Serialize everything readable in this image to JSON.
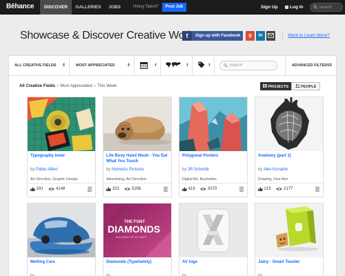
{
  "topnav": {
    "logo": "Bēhance",
    "items": [
      {
        "label": "DISCOVER",
        "active": true
      },
      {
        "label": "GALLERIES",
        "active": false
      },
      {
        "label": "JOBS",
        "active": false
      }
    ],
    "hiring_text": "Hiring Talent?",
    "post_job": "Post Job",
    "sign_up": "Sign Up",
    "log_in": "Log In",
    "search_placeholder": "Search"
  },
  "hero": {
    "title": "Showcase & Discover Creative Work:",
    "facebook_button": "Sign up with Facebook",
    "learn_more": "Want to Learn More?"
  },
  "filters": {
    "creative_fields": "ALL CREATIVE FIELDS",
    "sort": "MOST APPRECIATED",
    "search_placeholder": "Search",
    "advanced": "ADVANCED FILTERS"
  },
  "breadcrumb": {
    "root": "All Creative Fields",
    "sort": "Most Appreciated",
    "period": "This Week"
  },
  "view_toggle": {
    "projects": "PROJECTS",
    "people": "PEOPLE",
    "active": "projects"
  },
  "colors": {
    "accent": "#1769ff",
    "facebook": "#3b5998",
    "google": "#dd4b39",
    "linkedin": "#0e76a8",
    "email": "#444444"
  },
  "projects": [
    {
      "title": "Typography lover",
      "by": "by",
      "author": "Pablo Alfieri",
      "fields": "Art Direction, Graphic Design",
      "likes": "291",
      "views": "4148"
    },
    {
      "title": "Life Buoy Hand Wash - You Eat What You Touch",
      "by": "by",
      "author": "Nemesis Pictures",
      "fields": "Advertising, Art Direction",
      "likes": "323",
      "views": "5256"
    },
    {
      "title": "Polygonal Posters",
      "by": "by",
      "author": "JR Schmidt",
      "fields": "Digital Art, Illustration",
      "likes": "419",
      "views": "3073"
    },
    {
      "title": "Anatomy (part 1)",
      "by": "by",
      "author": "Alex Konahin",
      "fields": "Drawing, Fine Arts",
      "likes": "215",
      "views": "2177"
    },
    {
      "title": "Melting Cars",
      "by": "by",
      "author": "",
      "fields": "",
      "likes": "",
      "views": ""
    },
    {
      "title": "Diamonds (Typefamily)",
      "by": "by",
      "author": "",
      "fields": "",
      "likes": "",
      "views": ""
    },
    {
      "title": "AV logo",
      "by": "by",
      "author": "",
      "fields": "",
      "likes": "",
      "views": ""
    },
    {
      "title": "Jamy - Smart Toaster",
      "by": "by",
      "author": "",
      "fields": "",
      "likes": "",
      "views": ""
    }
  ],
  "thumb_text": {
    "diamonds_small": "THE FONT",
    "diamonds_big": "DIAMONDS",
    "diamonds_sub": "IN A FAMILY OF 13 FONTS"
  }
}
